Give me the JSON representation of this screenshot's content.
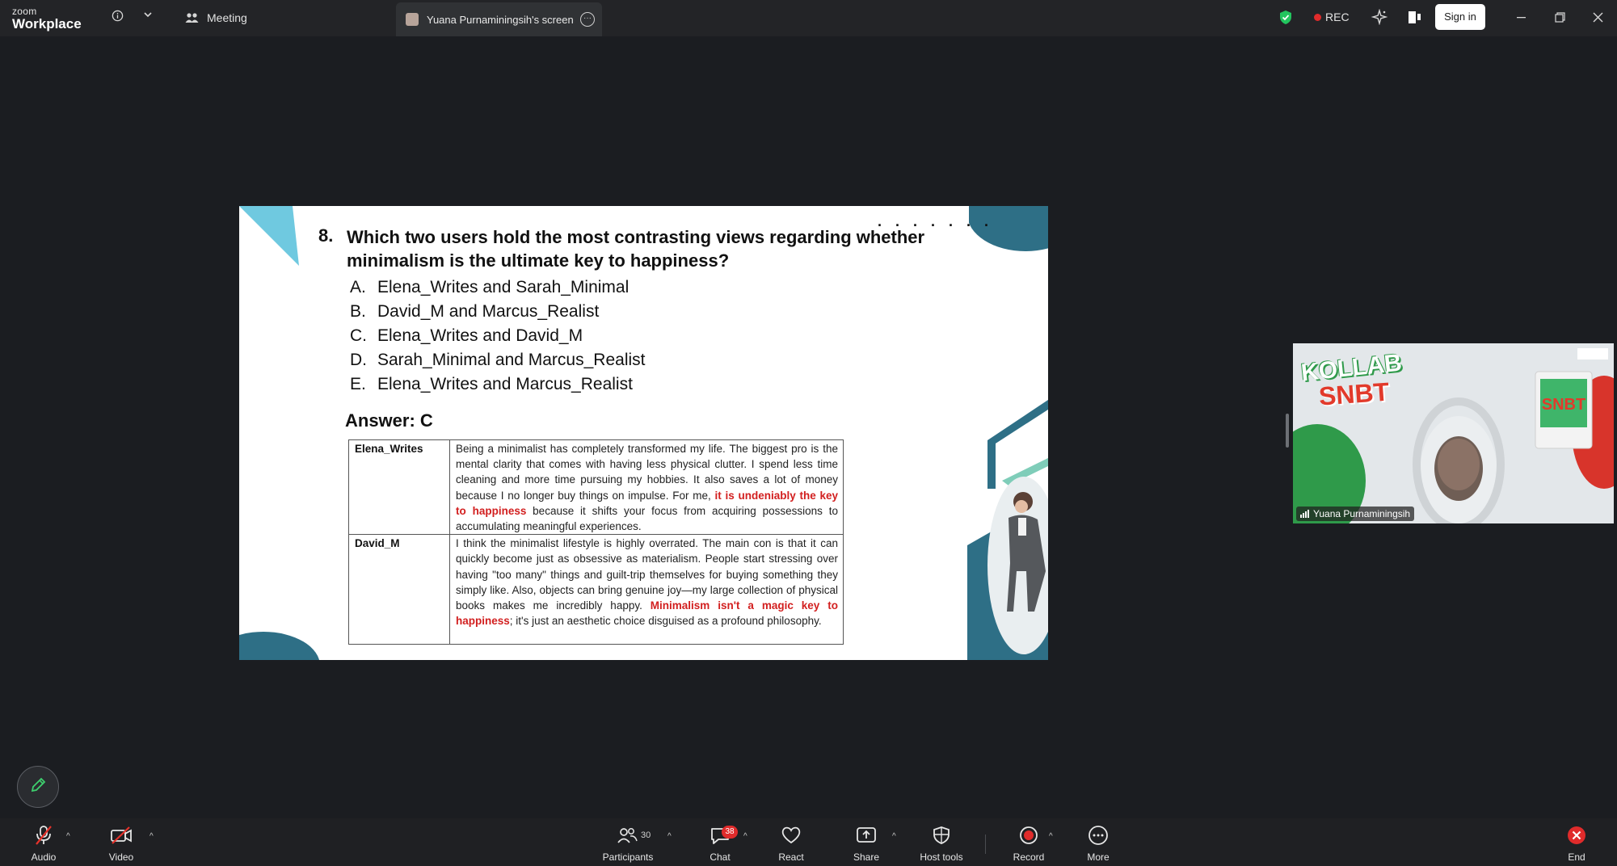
{
  "app": {
    "logo_line1": "zoom",
    "logo_line2": "Workplace"
  },
  "topbar": {
    "meeting_label": "Meeting",
    "screen_tab_label": "Yuana Purnaminingsih's screen",
    "rec_label": "REC",
    "sign_in_label": "Sign in",
    "rec_color": "#e02b2b",
    "shield_color": "#22c55e"
  },
  "slide": {
    "question_number": "8.",
    "question_text": "Which two users hold the most contrasting views regarding whether minimalism is the ultimate key to happiness?",
    "dots": ". . . . . . .",
    "options": [
      {
        "letter": "A.",
        "text": "Elena_Writes and Sarah_Minimal"
      },
      {
        "letter": "B.",
        "text": "David_M and Marcus_Realist"
      },
      {
        "letter": "C.",
        "text": "Elena_Writes and David_M"
      },
      {
        "letter": "D.",
        "text": "Sarah_Minimal and Marcus_Realist"
      },
      {
        "letter": "E.",
        "text": "Elena_Writes and Marcus_Realist"
      }
    ],
    "answer": "Answer: C",
    "posts": [
      {
        "user": "Elena_Writes",
        "text_before": "Being a minimalist has completely transformed my life. The biggest pro is the mental clarity that comes with having less physical clutter. I spend less time cleaning and more time pursuing my hobbies. It also saves a lot of money because I no longer buy things on impulse. For me, ",
        "highlight": "it is undeniably the key to happiness",
        "text_after": " because it shifts your focus from acquiring possessions to accumulating meaningful experiences."
      },
      {
        "user": "David_M",
        "text_before": "I think the minimalist lifestyle is highly overrated. The main con is that it can quickly become just as obsessive as materialism. People start stressing over having \"too many\" things and guilt-trip themselves for buying something they simply like. Also, objects can bring genuine joy—my large collection of physical books makes me incredibly happy. ",
        "highlight": "Minimalism isn't a magic key to happiness",
        "text_after": "; it's just an aesthetic choice disguised as a profound philosophy."
      }
    ],
    "accent_color": "#2e6f86",
    "accent_light": "#6fc9e0",
    "highlight_color": "#d21f1f"
  },
  "video_tile": {
    "participant_name": "Yuana Purnaminingsih",
    "banner_word1": "KOLLAB",
    "banner_word2": "SNBT",
    "book_label": "SNBT"
  },
  "toolbar": {
    "audio_label": "Audio",
    "video_label": "Video",
    "participants_label": "Participants",
    "participants_count": "30",
    "chat_label": "Chat",
    "chat_badge": "38",
    "react_label": "React",
    "share_label": "Share",
    "host_tools_label": "Host tools",
    "record_label": "Record",
    "more_label": "More",
    "end_label": "End"
  }
}
